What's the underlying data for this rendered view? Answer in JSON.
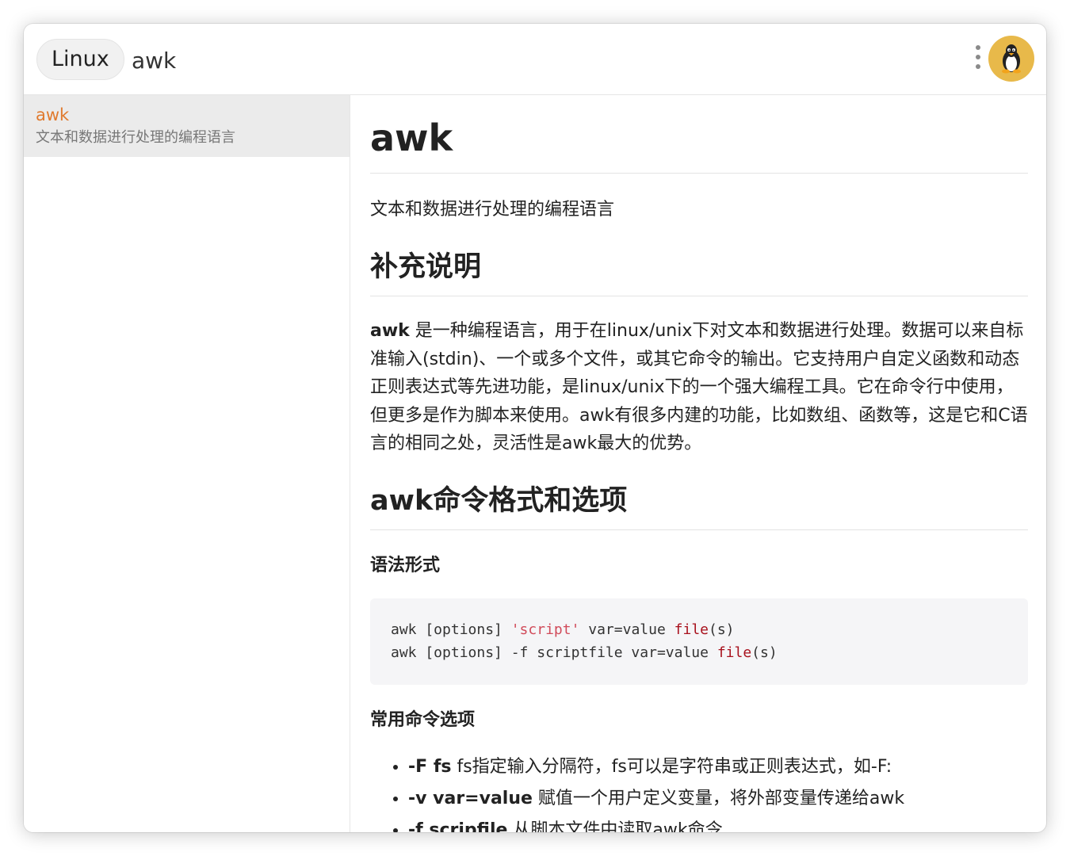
{
  "header": {
    "badge": "Linux",
    "search_value": "awk"
  },
  "sidebar": {
    "results": [
      {
        "title": "awk",
        "desc": "文本和数据进行处理的编程语言"
      }
    ]
  },
  "content": {
    "title": "awk",
    "description": "文本和数据进行处理的编程语言",
    "section1": {
      "heading": "补充说明",
      "paragraph_bold": "awk",
      "paragraph": " 是一种编程语言，用于在linux/unix下对文本和数据进行处理。数据可以来自标准输入(stdin)、一个或多个文件，或其它命令的输出。它支持用户自定义函数和动态正则表达式等先进功能，是linux/unix下的一个强大编程工具。它在命令行中使用，但更多是作为脚本来使用。awk有很多内建的功能，比如数组、函数等，这是它和C语言的相同之处，灵活性是awk最大的优势。"
    },
    "section2": {
      "heading": "awk命令格式和选项",
      "syntax_heading": "语法形式",
      "code": [
        {
          "a": "awk [options] ",
          "str": "'script'",
          "b": " var=value ",
          "kw": "file",
          "c": "(s)"
        },
        {
          "a": "awk [options] -f scriptfile var=value ",
          "kw": "file",
          "c": "(s)"
        }
      ],
      "options_heading": "常用命令选项",
      "options": [
        {
          "opt": "-F fs",
          "text": " fs指定输入分隔符，fs可以是字符串或正则表达式，如-F:"
        },
        {
          "opt": "-v var=value",
          "text": " 赋值一个用户定义变量，将外部变量传递给awk"
        },
        {
          "opt": "-f scripfile",
          "text": " 从脚本文件中读取awk命令"
        }
      ]
    }
  },
  "colors": {
    "accent": "#e07a2e",
    "avatar_bg": "#e8b94a",
    "code_string": "#d14b5a",
    "code_keyword": "#a8111d"
  },
  "icons": [
    "more-vertical-icon",
    "linux-penguin-icon"
  ]
}
